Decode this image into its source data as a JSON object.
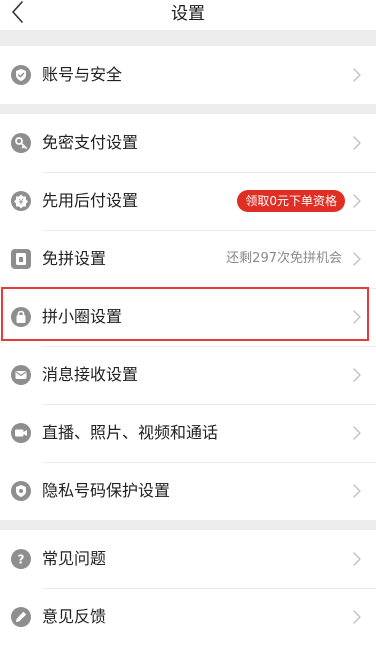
{
  "header": {
    "title": "设置"
  },
  "groups": [
    {
      "items": [
        {
          "label": "账号与安全",
          "icon": "shield-icon"
        }
      ]
    },
    {
      "items": [
        {
          "label": "免密支付设置",
          "icon": "key-icon"
        },
        {
          "label": "先用后付设置",
          "icon": "badge-icon",
          "badge": "领取0元下单资格"
        },
        {
          "label": "免拼设置",
          "icon": "ticket-icon",
          "hint": "还剩297次免拼机会"
        },
        {
          "label": "拼小圈设置",
          "icon": "bag-icon",
          "highlighted": true
        },
        {
          "label": "消息接收设置",
          "icon": "message-icon"
        },
        {
          "label": "直播、照片、视频和通话",
          "icon": "video-icon"
        },
        {
          "label": "隐私号码保护设置",
          "icon": "privacy-shield-icon"
        }
      ]
    },
    {
      "items": [
        {
          "label": "常见问题",
          "icon": "question-icon"
        },
        {
          "label": "意见反馈",
          "icon": "pencil-icon"
        }
      ]
    }
  ],
  "colors": {
    "page_background": "#ededed",
    "icon_gray": "#8e8e8e",
    "badge_red": "#e02e24",
    "highlight_red": "#e83a3a"
  }
}
